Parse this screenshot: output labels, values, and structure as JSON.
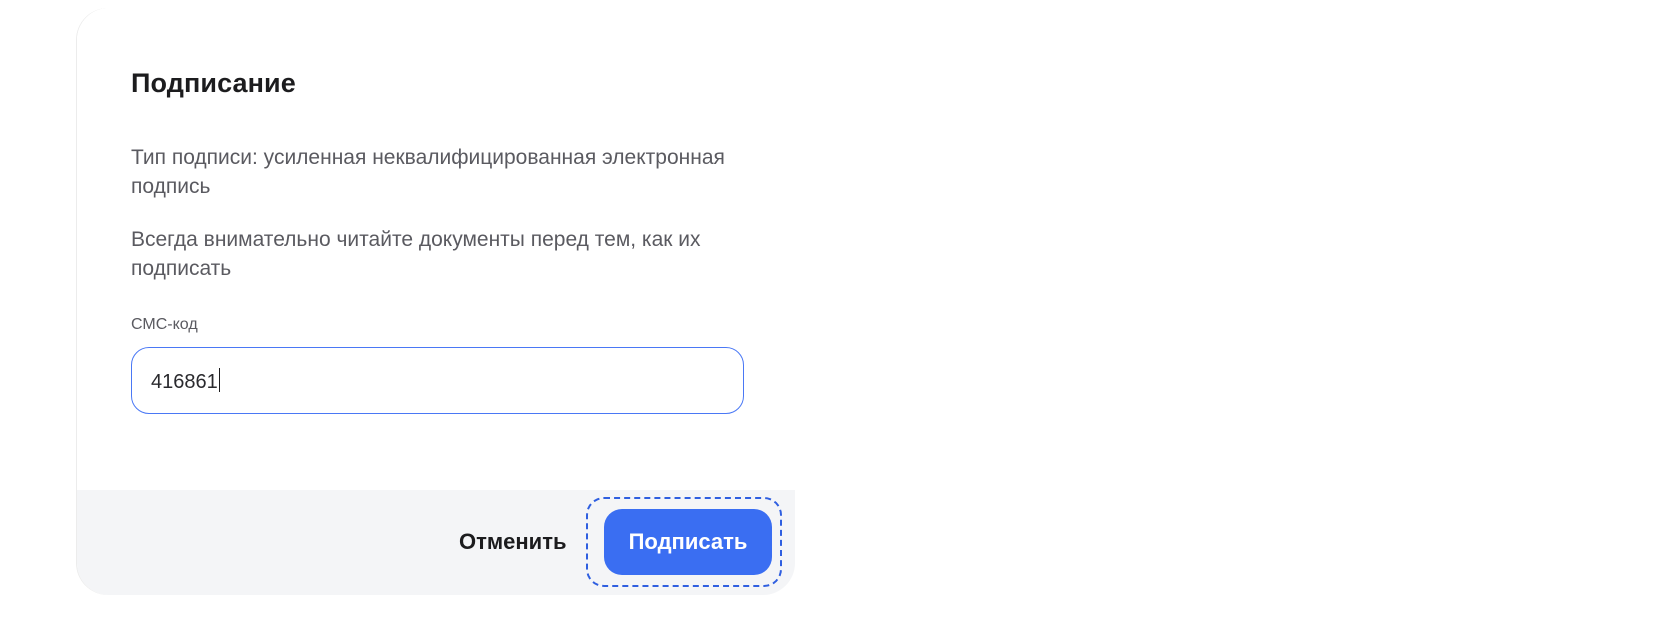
{
  "dialog": {
    "title": "Подписание",
    "signature_type": "Тип подписи: усиленная неквалифицированная электронная подпись",
    "warning": "Всегда внимательно читайте документы перед тем, как их подписать",
    "sms_code": {
      "label": "СМС-код",
      "value": "416861"
    }
  },
  "footer": {
    "cancel_label": "Отменить",
    "sign_label": "Подписать"
  },
  "colors": {
    "accent": "#3a6ef2",
    "focus_ring": "#2f5fe0",
    "footer_background": "#f4f5f7"
  }
}
